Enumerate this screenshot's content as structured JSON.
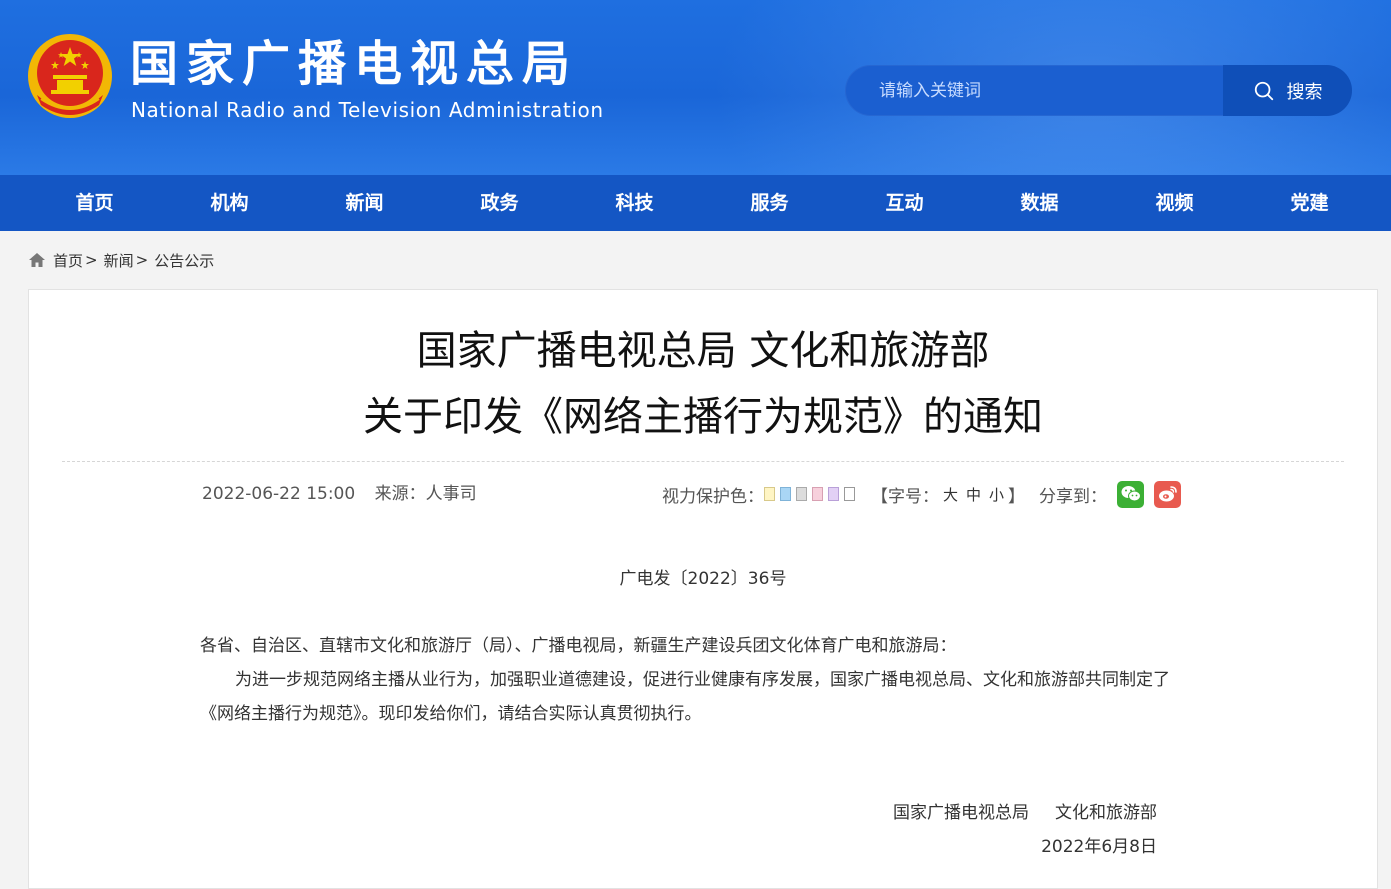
{
  "header": {
    "title": "国家广播电视总局",
    "subtitle": "National Radio and Television Administration",
    "emblem": "national-emblem-icon"
  },
  "search": {
    "placeholder": "请输入关键词",
    "button_label": "搜索",
    "icon": "search-icon"
  },
  "nav": {
    "items": [
      "首页",
      "机构",
      "新闻",
      "政务",
      "科技",
      "服务",
      "互动",
      "数据",
      "视频",
      "党建"
    ]
  },
  "breadcrumb": {
    "home": "首页",
    "sep1": ">",
    "news": "新闻",
    "sep2": ">",
    "current": "公告公示"
  },
  "article": {
    "title_line1": "国家广播电视总局 文化和旅游部",
    "title_line2": "关于印发《网络主播行为规范》的通知",
    "datetime": "2022-06-22 15:00",
    "source": "来源：人事司",
    "eye_care_label": "视力保护色：",
    "eye_care_colors": [
      "#fff5c4",
      "#a9d6f5",
      "#dcdcdc",
      "#f7d0dc",
      "#e2d0f5",
      "#ffffff"
    ],
    "font_label_open": "【字号：",
    "font_large": "大",
    "font_medium": "中",
    "font_small": "小",
    "font_label_close": "】",
    "share_label": "分享到：",
    "share_wechat_color": "#3cb035",
    "share_weibo_color": "#e85a4f",
    "doc_number": "广电发〔2022〕36号",
    "salutation": "各省、自治区、直辖市文化和旅游厅（局）、广播电视局，新疆生产建设兵团文化体育广电和旅游局：",
    "paragraph1": "为进一步规范网络主播从业行为，加强职业道德建设，促进行业健康有序发展，国家广播电视总局、文化和旅游部共同制定了《网络主播行为规范》。现印发给你们，请结合实际认真贯彻执行。",
    "signer1": "国家广播电视总局",
    "signer2": "文化和旅游部",
    "sign_date": "2022年6月8日"
  },
  "colors": {
    "header_blue": "#1f6fe0",
    "nav_blue": "#1456c4",
    "search_button": "#0f4fb8"
  }
}
